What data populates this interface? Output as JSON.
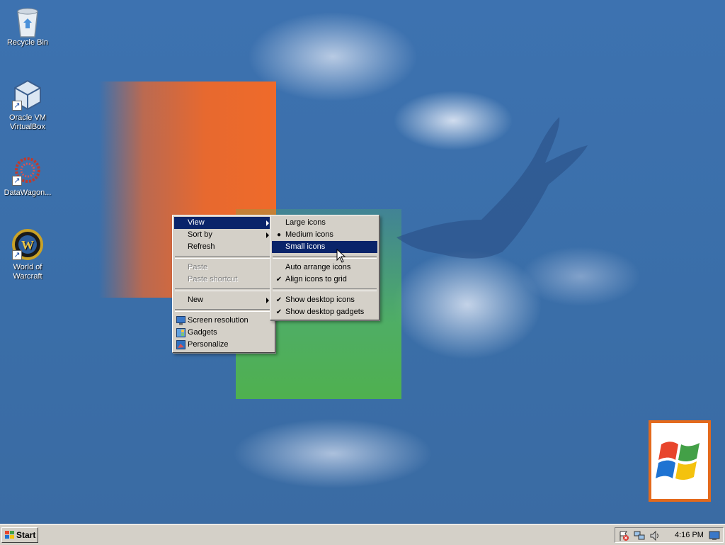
{
  "desktop_icons": [
    {
      "label": "Recycle Bin",
      "icon": "recycle-bin-icon"
    },
    {
      "label": "Oracle VM VirtualBox",
      "icon": "virtualbox-icon",
      "shortcut": true
    },
    {
      "label": "DataWagon...",
      "icon": "datawagon-icon",
      "shortcut": true
    },
    {
      "label": "World of Warcraft",
      "icon": "world-of-warcraft-icon",
      "shortcut": true
    }
  ],
  "context_menu": {
    "items": [
      {
        "label": "View",
        "submenu": true,
        "highlighted": true
      },
      {
        "label": "Sort by",
        "submenu": true
      },
      {
        "label": "Refresh"
      },
      {
        "label": "Paste",
        "disabled": true
      },
      {
        "label": "Paste shortcut",
        "disabled": true
      },
      {
        "label": "New",
        "submenu": true
      },
      {
        "label": "Screen resolution",
        "icon": "screen-resolution-icon"
      },
      {
        "label": "Gadgets",
        "icon": "gadgets-icon"
      },
      {
        "label": "Personalize",
        "icon": "personalize-icon"
      }
    ]
  },
  "view_submenu": {
    "items": [
      {
        "label": "Large icons"
      },
      {
        "label": "Medium icons",
        "mark": "●"
      },
      {
        "label": "Small icons",
        "highlighted": true
      },
      {
        "label": "Auto arrange icons"
      },
      {
        "label": "Align icons to grid",
        "mark": "✔"
      },
      {
        "label": "Show desktop icons",
        "mark": "✔"
      },
      {
        "label": "Show desktop gadgets",
        "mark": "✔"
      }
    ]
  },
  "taskbar": {
    "start_label": "Start",
    "clock": "4:16 PM",
    "tray_icons": [
      "action-center-icon",
      "network-icon",
      "volume-icon",
      "show-desktop-icon"
    ]
  },
  "colors": {
    "desktop_bg": "#3a6ea5",
    "menu_bg": "#d4d0c8",
    "highlight": "#0a246a",
    "orange_square": "#e7692f",
    "green_square": "#4fb04f"
  }
}
